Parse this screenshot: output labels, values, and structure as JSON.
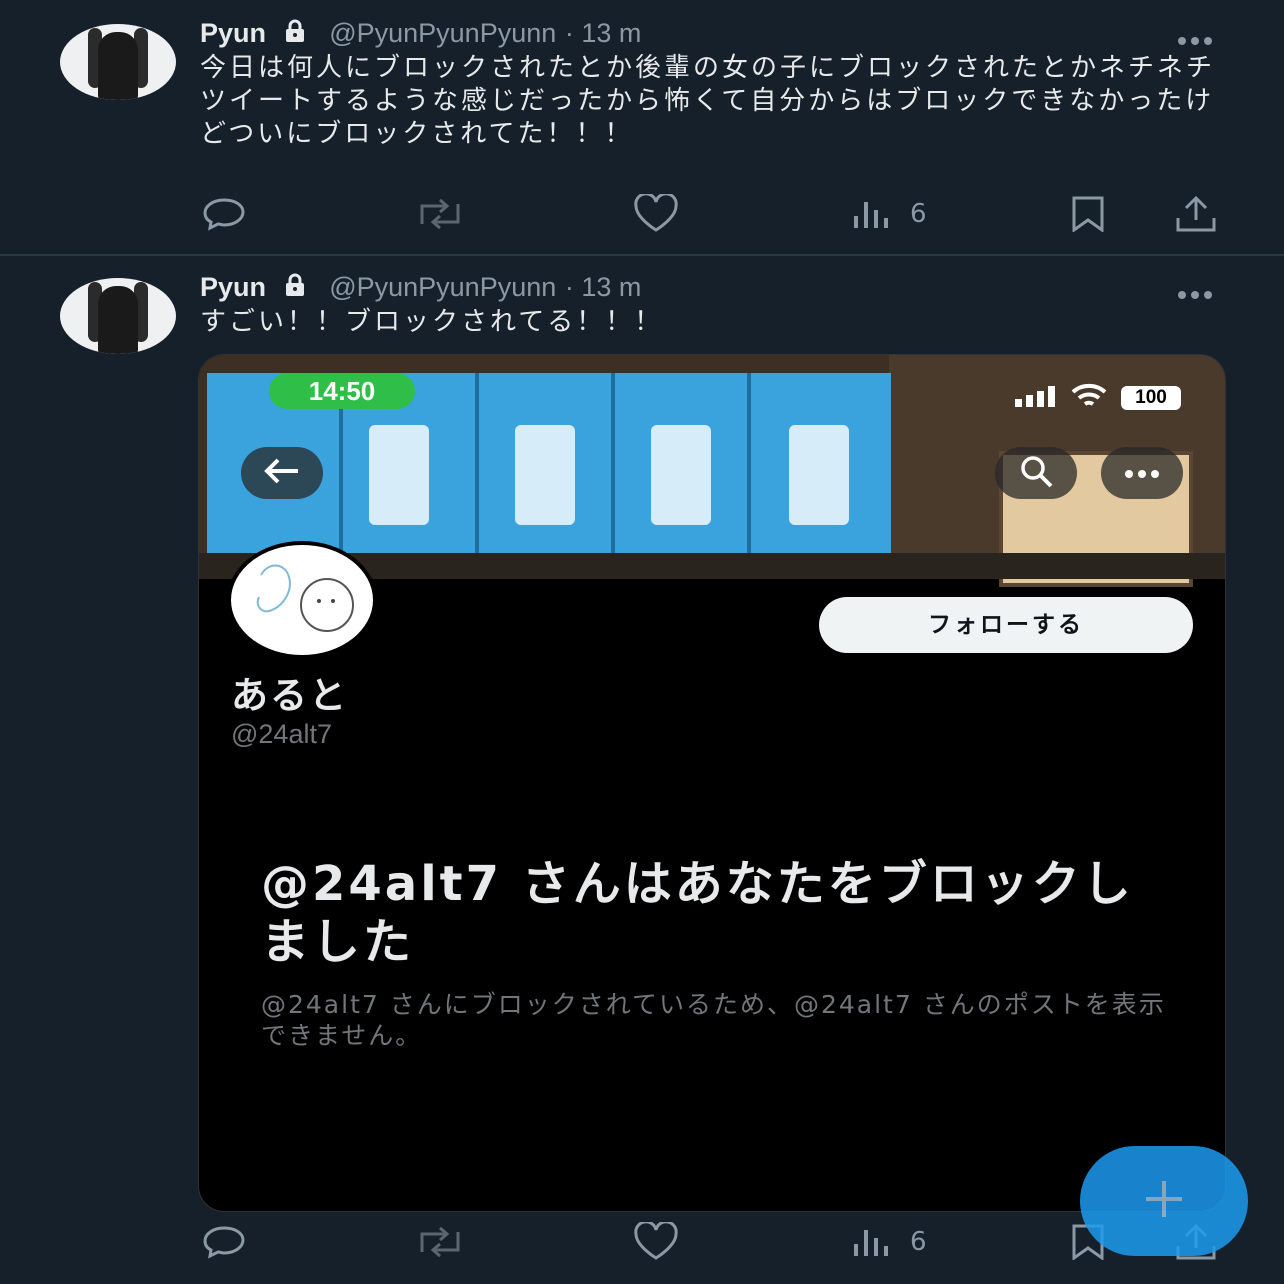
{
  "colors": {
    "background": "#15202b",
    "accent": "#1d9bf0",
    "muted": "#8b98a5"
  },
  "tweets": [
    {
      "author_name": "Pyun",
      "author_handle": "@PyunPyunPyunn",
      "time": "· 13 m",
      "text": "今日は何人にブロックされたとか後輩の女の子にブロックされたとかネチネチツイートするような感じだったから怖くて自分からはブロックできなかったけどついにブロックされてた！！！",
      "views": "6"
    },
    {
      "author_name": "Pyun",
      "author_handle": "@PyunPyunPyunn",
      "time": "· 13 m",
      "text": "すごい！！ブロックされてる！！！",
      "views": "6",
      "screenshot": {
        "clock": "14:50",
        "battery": "100",
        "follow_label": "フォローする",
        "profile_name": "あると",
        "profile_handle": "@24alt7",
        "blocked_title": "@24alt7 さんはあなたをブロックしました",
        "blocked_desc": "@24alt7 さんにブロックされているため、@24alt7 さんのポストを表示できません。"
      }
    }
  ],
  "icons": [
    "reply-icon",
    "retweet-icon",
    "like-icon",
    "views-icon",
    "bookmark-icon",
    "share-icon",
    "lock-icon",
    "more-icon",
    "compose-plus-icon",
    "back-arrow-icon",
    "search-icon"
  ]
}
